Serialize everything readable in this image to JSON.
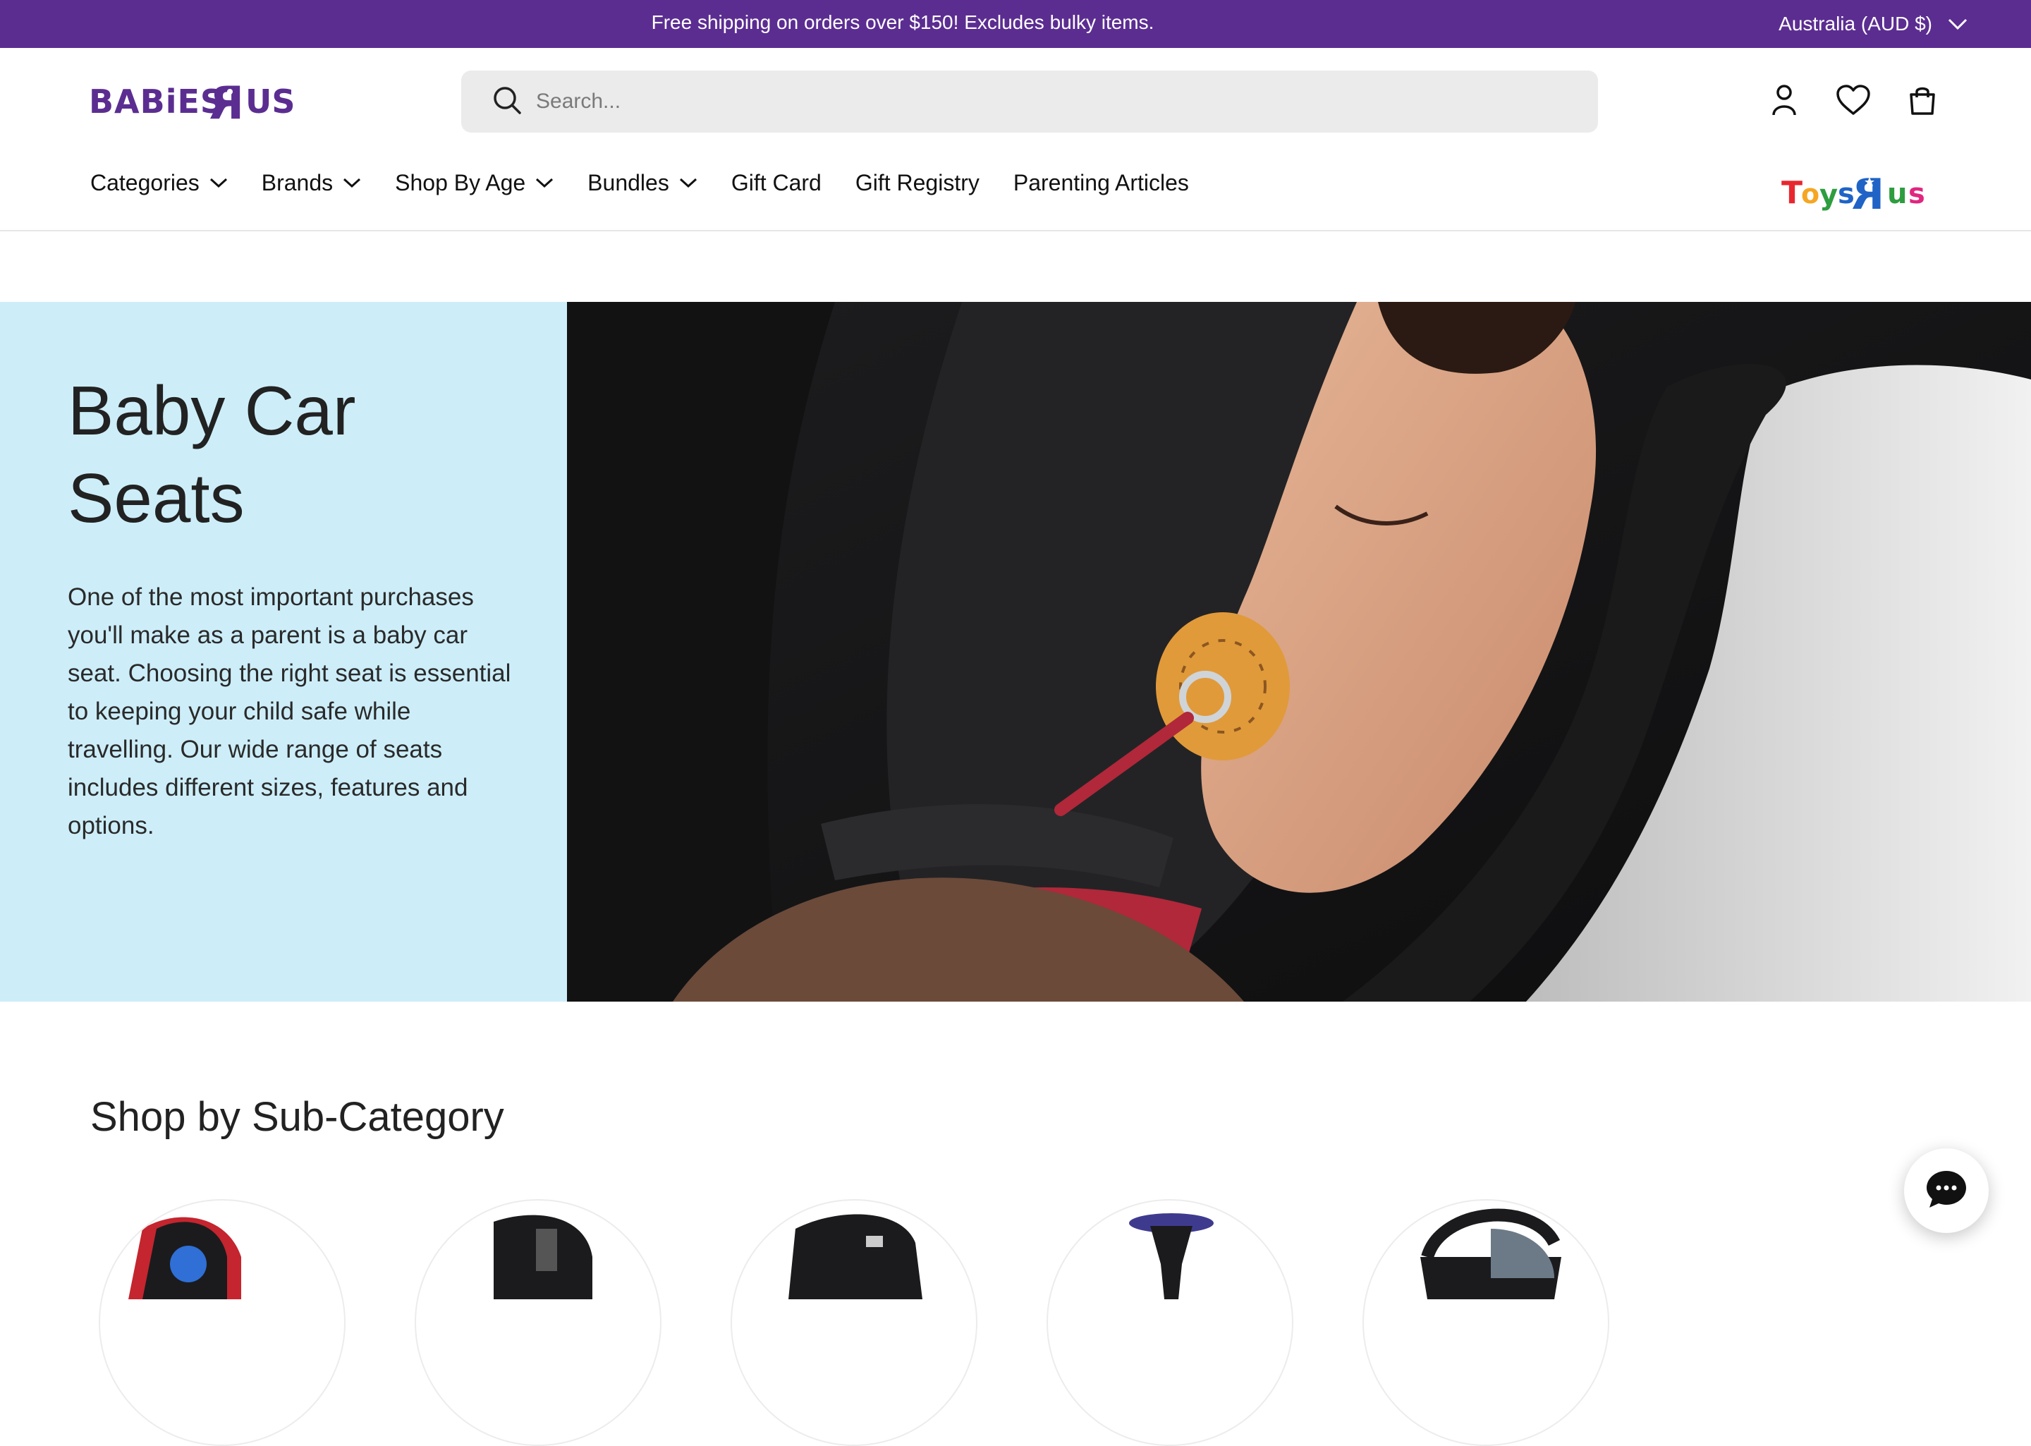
{
  "announcement": {
    "text": "Free shipping on orders over $150! Excludes bulky items.",
    "locale": "Australia (AUD $)"
  },
  "header": {
    "logo_text": "BABIES R US",
    "search_placeholder": "Search...",
    "icons": [
      "account-icon",
      "wishlist-heart-icon",
      "cart-bag-icon"
    ],
    "partner_logo_text": "TOYS R US"
  },
  "nav": {
    "items": [
      {
        "label": "Categories",
        "has_dropdown": true
      },
      {
        "label": "Brands",
        "has_dropdown": true
      },
      {
        "label": "Shop By Age",
        "has_dropdown": true
      },
      {
        "label": "Bundles",
        "has_dropdown": true
      },
      {
        "label": "Gift Card",
        "has_dropdown": false
      },
      {
        "label": "Gift Registry",
        "has_dropdown": false
      },
      {
        "label": "Parenting Articles",
        "has_dropdown": false
      }
    ]
  },
  "hero": {
    "title": "Baby Car Seats",
    "description": "One of the most important purchases you'll make as a parent is a baby car seat. Choosing the right seat is essential to keeping your child safe while travelling. Our wide range of seats includes different sizes, features and options."
  },
  "subcategory": {
    "heading": "Shop by Sub-Category"
  },
  "colors": {
    "brand_purple": "#5b2d91",
    "hero_bg": "#cdeef9"
  }
}
